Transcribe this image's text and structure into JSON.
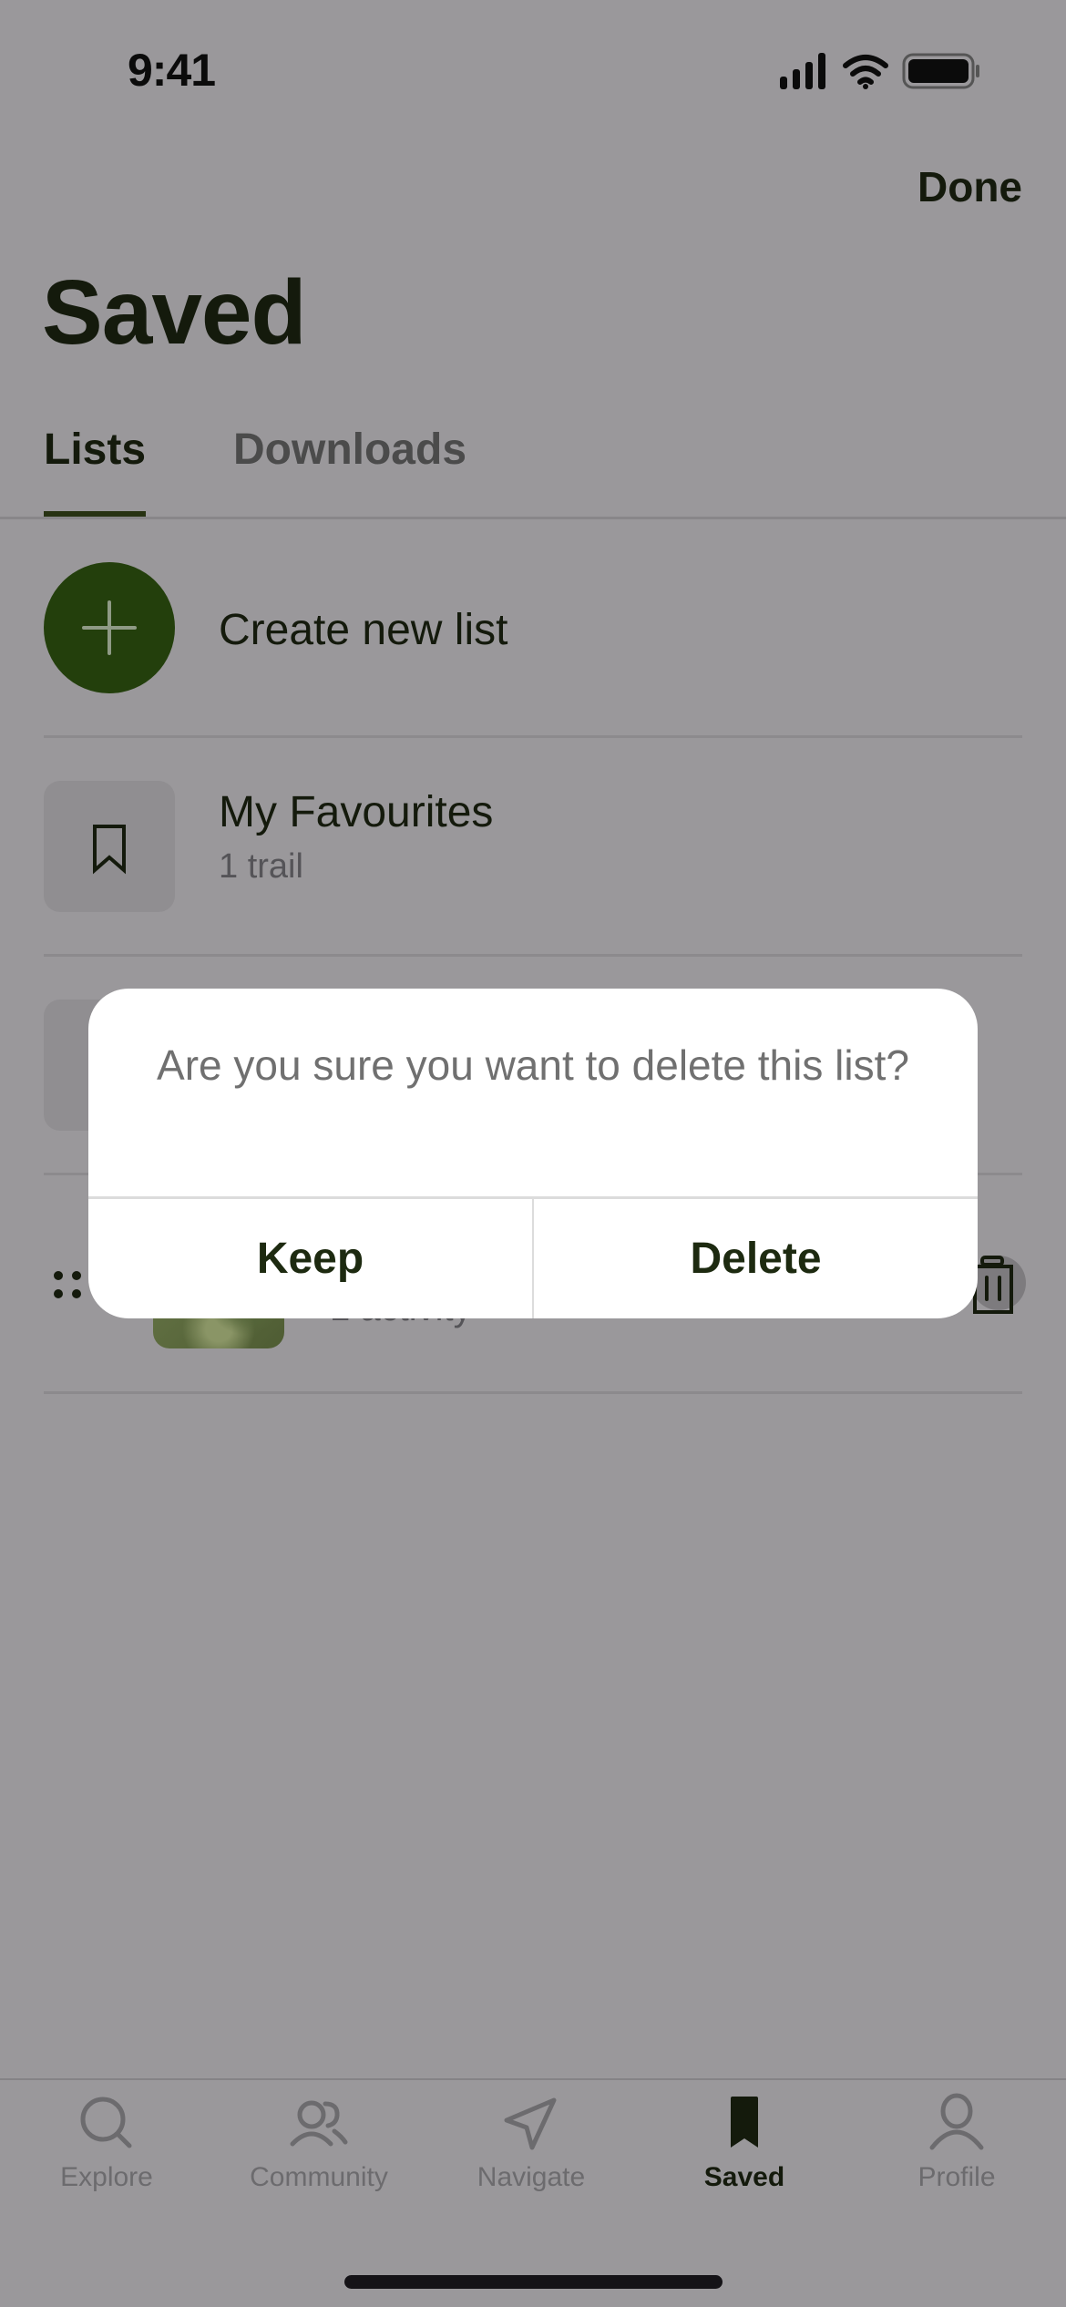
{
  "status_bar": {
    "time": "9:41",
    "icons": [
      "cellular-signal-icon",
      "wifi-icon",
      "battery-icon"
    ]
  },
  "header": {
    "done_label": "Done",
    "title": "Saved"
  },
  "tabs": [
    {
      "label": "Lists",
      "active": true
    },
    {
      "label": "Downloads",
      "active": false
    }
  ],
  "create_row": {
    "icon": "plus-icon",
    "label": "Create new list"
  },
  "lists": [
    {
      "title": "My Favourites",
      "subtitle": "1 trail",
      "icon": "bookmark-icon"
    },
    {
      "title": "",
      "subtitle": "",
      "icon": "bookmark-icon"
    },
    {
      "title": "",
      "subtitle": "1 activity",
      "icon": "thumbnail-image",
      "editing": true
    }
  ],
  "dialog": {
    "message": "Are you sure you want to delete this list?",
    "keep_label": "Keep",
    "delete_label": "Delete"
  },
  "tabbar": {
    "items": [
      {
        "label": "Explore",
        "icon": "search-icon",
        "active": false
      },
      {
        "label": "Community",
        "icon": "community-icon",
        "active": false
      },
      {
        "label": "Navigate",
        "icon": "navigate-arrow-icon",
        "active": false
      },
      {
        "label": "Saved",
        "icon": "bookmark-filled-icon",
        "active": true
      },
      {
        "label": "Profile",
        "icon": "profile-icon",
        "active": false
      }
    ]
  },
  "colors": {
    "accent_green": "#233f0c",
    "text_dark": "#141a0c",
    "overlay_background": "#9a989b",
    "dialog_background": "#ffffff"
  }
}
